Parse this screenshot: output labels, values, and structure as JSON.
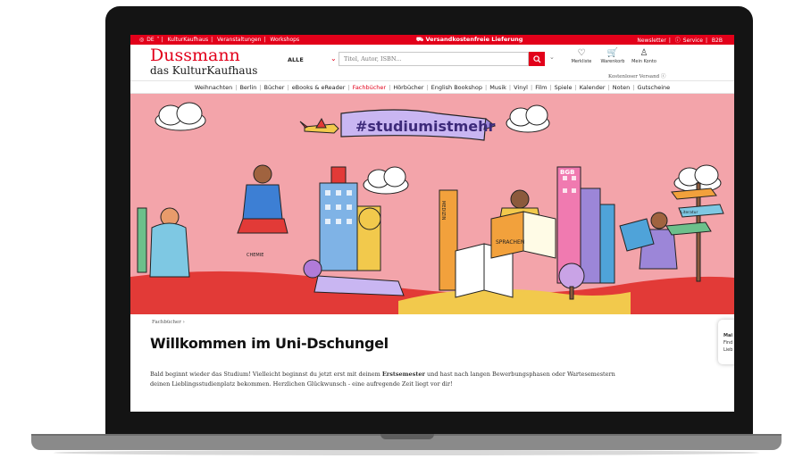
{
  "utility_bar": {
    "left_items": [
      "DE",
      "KulturKaufhaus",
      "Veranstaltungen",
      "Workshops"
    ],
    "center_text": "Versandkostenfreie Lieferung",
    "right_items": [
      "Newsletter",
      "Service",
      "B2B"
    ]
  },
  "header": {
    "logo_line1": "Dussmann",
    "logo_line2": "das KulturKaufhaus",
    "search_scope": "ALLE",
    "search_placeholder": "Titel, Autor, ISBN...",
    "icons": [
      {
        "label": "Merkliste",
        "icon": "heart-icon"
      },
      {
        "label": "Warenkorb",
        "icon": "cart-icon"
      },
      {
        "label": "Mein Konto",
        "icon": "user-icon"
      }
    ],
    "shipping_note": "Kostenloser Versand"
  },
  "nav": {
    "items": [
      "Weihnachten",
      "Berlin",
      "Bücher",
      "eBooks & eReader",
      "Fachbücher",
      "Hörbücher",
      "English Bookshop",
      "Musik",
      "Vinyl",
      "Film",
      "Spiele",
      "Kalender",
      "Noten",
      "Gutscheine"
    ],
    "active": "Fachbücher"
  },
  "hero": {
    "banner_text": "#studiumistmehr",
    "book_labels": [
      "MEDIZIN",
      "BGB",
      "SPRACHEN",
      "CHEMIE",
      "Literatur"
    ]
  },
  "content": {
    "breadcrumb": "Fachbücher",
    "title": "Willkommen im Uni-Dschungel",
    "intro_start": "Bald beginnt wieder das Studium! Vielleicht beginnst du jetzt erst mit deinem ",
    "intro_bold": "Erstsemester",
    "intro_end": " und hast nach langen Bewerbungsphasen oder Wartesemestern",
    "intro_line2": "deinen Lieblingsstudienplatz bekommen. Herzlichen Glückwunsch - eine aufregende Zeit liegt vor dir!",
    "side_card_title": "Mai",
    "side_card_lines": [
      "Find",
      "Lieb"
    ]
  },
  "colors": {
    "brand_red": "#e2001a",
    "hero_pink": "#f3a4aa",
    "floor_red": "#e23a37"
  }
}
